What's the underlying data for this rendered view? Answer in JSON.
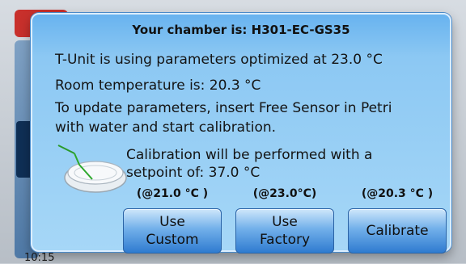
{
  "background": {
    "clock": "10:15"
  },
  "dialog": {
    "title": "Your chamber is: H301-EC-GS35",
    "line1": "T-Unit is using parameters optimized at 23.0 °C",
    "line2": "Room temperature is: 20.3 °C",
    "line3": "To update parameters, insert Free Sensor in Petri",
    "line4": "with water and start calibration.",
    "calibration_note_1": "Calibration will be performed with a",
    "calibration_note_2": "setpoint of: 37.0 °C",
    "options": [
      {
        "caption": "(@21.0 °C )",
        "label_line1": "Use",
        "label_line2": "Custom"
      },
      {
        "caption": "(@23.0°C)",
        "label_line1": "Use",
        "label_line2": "Factory"
      },
      {
        "caption": "(@20.3 °C )",
        "label_line1": "Calibrate",
        "label_line2": ""
      }
    ]
  },
  "icons": {
    "petri": "petri-dish-icon"
  },
  "colors": {
    "dialog_top": "#68b3ef",
    "dialog_bottom": "#a6d7f7",
    "button": "#2f7bd0"
  }
}
